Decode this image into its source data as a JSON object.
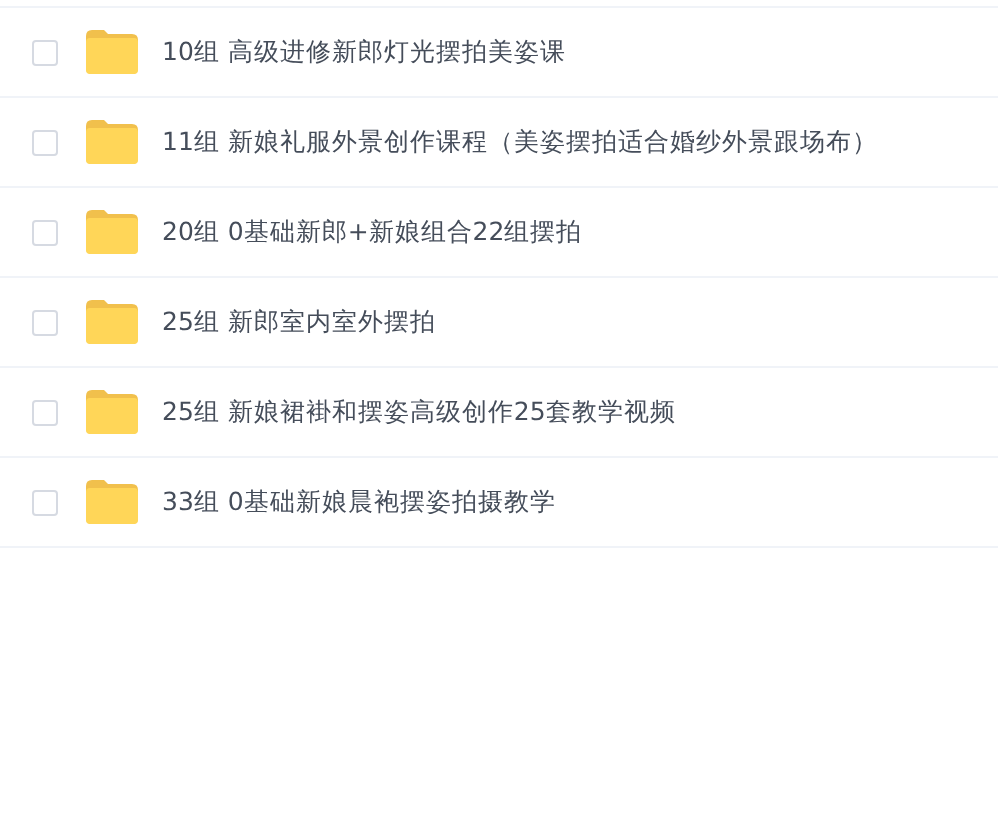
{
  "files": [
    {
      "name": "10组 高级进修新郎灯光摆拍美姿课",
      "checked": false
    },
    {
      "name": "11组 新娘礼服外景创作课程（美姿摆拍适合婚纱外景跟场布）",
      "checked": false
    },
    {
      "name": "20组 0基础新郎+新娘组合22组摆拍",
      "checked": false
    },
    {
      "name": "25组 新郎室内室外摆拍",
      "checked": false
    },
    {
      "name": "25组 新娘裙褂和摆姿高级创作25套教学视频",
      "checked": false
    },
    {
      "name": "33组 0基础新娘晨袍摆姿拍摄教学",
      "checked": false
    }
  ]
}
